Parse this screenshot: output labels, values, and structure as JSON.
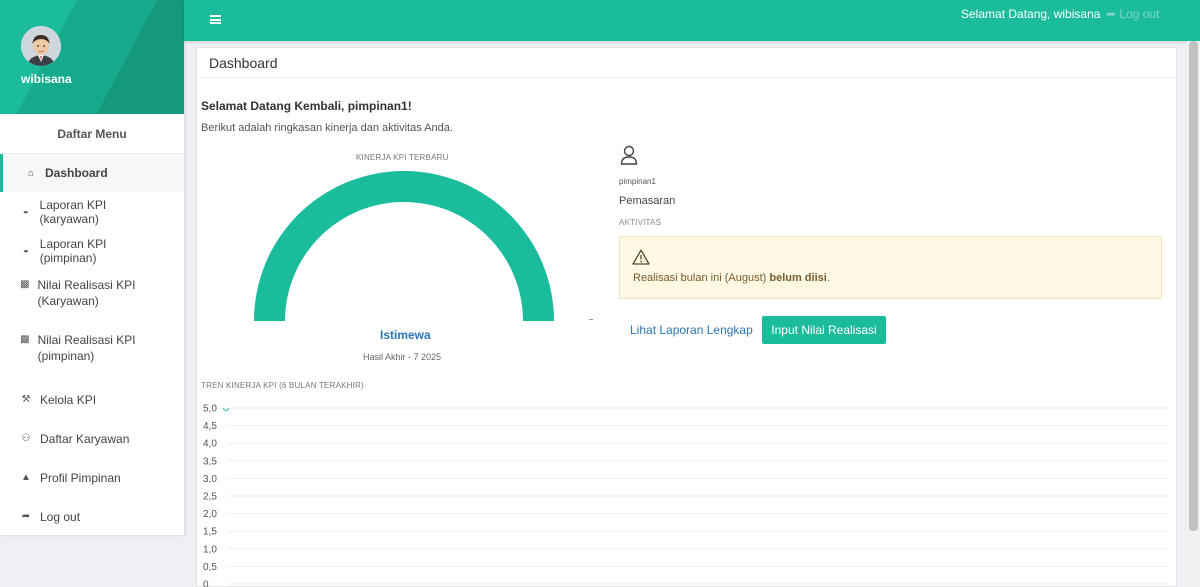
{
  "sidebar": {
    "username": "wibisana",
    "menu_title": "Daftar Menu",
    "items": [
      {
        "label": "Dashboard",
        "icon": "home-icon",
        "glyph": "⌂"
      },
      {
        "label": "Laporan KPI (karyawan)",
        "icon": "dashboard-icon",
        "glyph": "◒"
      },
      {
        "label": "Laporan KPI (pimpinan)",
        "icon": "dashboard-icon",
        "glyph": "◒"
      },
      {
        "label": "Nilai Realisasi KPI (Karyawan)",
        "icon": "edit-icon",
        "glyph": "▩"
      },
      {
        "label": "Nilai Realisasi KPI (pimpinan)",
        "icon": "edit-icon",
        "glyph": "▩"
      },
      {
        "label": "Kelola KPI",
        "icon": "wrench-icon",
        "glyph": "⚒"
      },
      {
        "label": "Daftar Karyawan",
        "icon": "users-icon",
        "glyph": "⚇"
      },
      {
        "label": "Profil Pimpinan",
        "icon": "user-icon",
        "glyph": "▲"
      },
      {
        "label": "Log out",
        "icon": "sign-out-icon",
        "glyph": "➦"
      }
    ]
  },
  "topbar": {
    "welcome": "Selamat Datang, wibisana",
    "logout": "➦ Log out"
  },
  "main": {
    "title": "Dashboard",
    "greeting": "Selamat Datang Kembali, pimpinan1!",
    "summary": "Berikut adalah ringkasan kinerja dan aktivitas Anda.",
    "gauge": {
      "label": "KINERJA KPI TERBARU",
      "status": "Istimewa",
      "subtitle": "Hasil Akhir - 7 2025",
      "value_fraction": 1.0
    },
    "profile": {
      "username": "pimpinan1",
      "department": "Pemasaran"
    },
    "activity": {
      "label": "AKTIVITAS",
      "message_prefix": "Realisasi bulan ini (August) ",
      "message_bold": "belum diisi",
      "message_suffix": "."
    },
    "actions": {
      "report_link": "Lihat Laporan Lengkap",
      "input_button": "Input Nilai Realisasi"
    }
  },
  "colors": {
    "accent": "#1abc9c",
    "link": "#2a76b8",
    "warning_bg": "#fcf8e3"
  },
  "chart_data": {
    "type": "line",
    "title": "TREN KINERJA KPI (6 BULAN TERAKHIR)",
    "yticks": [
      "5,0",
      "4,5",
      "4,0",
      "3,5",
      "3,0",
      "2,5",
      "2,0",
      "1,5",
      "1,0",
      "0,5",
      "0"
    ],
    "ylim": [
      0,
      5
    ],
    "grid": true,
    "series": [
      {
        "values": [
          5.0
        ]
      }
    ]
  }
}
